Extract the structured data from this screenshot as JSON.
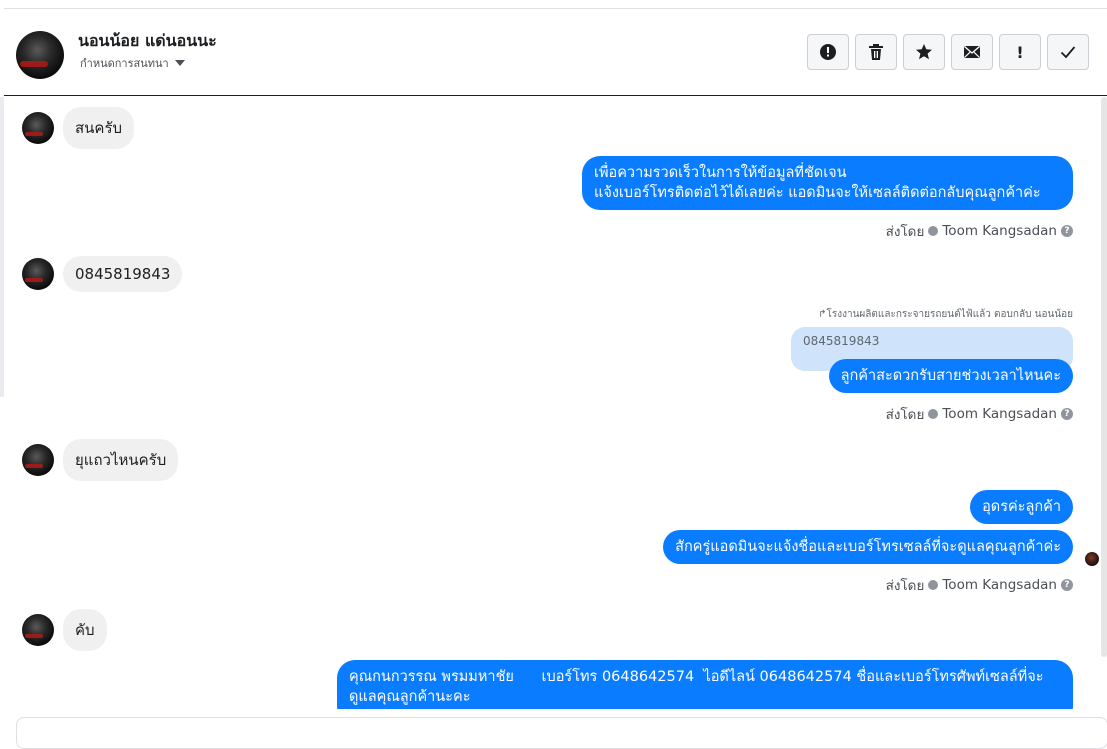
{
  "header": {
    "name": "นอนน้อย แด่นอนนะ",
    "subtitle": "กำหนดการสนทนา",
    "actions": [
      {
        "icon": "alert-circle-icon",
        "glyph": "!"
      },
      {
        "icon": "trash-icon",
        "glyph": ""
      },
      {
        "icon": "star-icon",
        "glyph": "★"
      },
      {
        "icon": "envelope-icon",
        "glyph": ""
      },
      {
        "icon": "exclamation-icon",
        "glyph": "!"
      },
      {
        "icon": "checkmark-icon",
        "glyph": "✓"
      }
    ]
  },
  "messages": {
    "in1": "สนครับ",
    "out1_line1": "เพื่อความรวดเร็วในการให้ข้อมูลที่ชัดเจน",
    "out1_line2": "แจ้งเบอร์โทรติดต่อไว้ได้เลยค่ะ แอดมินจะให้เซลล์ติดต่อกลับคุณลูกค้าค่ะ",
    "in2": "0845819843",
    "reply_note": "โรงงานผลิตและกระจายรถยนต์ไฟ้แล้ว ตอบกลับ นอนน้อย",
    "quoted": "0845819843",
    "out2": "ลูกค้าสะดวกรับสายช่วงเวลาไหนคะ",
    "in3": "ยุแถวไหนครับ",
    "out3": "อุดรค่ะลูกค้า",
    "out4": "สักครู่แอดมินจะแจ้งชื่อและเบอร์โทรเซลล์ที่จะดูแลคุณลูกค้าค่ะ",
    "in4": "คับ",
    "out5_line1": "คุณกนกวรรณ พรมมหาชัย      เบอร์โทร 0648642574  ไอดีไลน์ 0648642574 ชื่อและเบอร์โทรศัพท์เซลล์ที่จะ",
    "out5_line2": "ดูแลคุณลูกค้านะคะ"
  },
  "sent_by": {
    "prefix": "ส่งโดย",
    "agent": "Toom Kangsadan"
  },
  "colors": {
    "outgoing": "#0a7cff",
    "incoming": "#f1f0f0",
    "quoted": "#cfe3fb"
  }
}
